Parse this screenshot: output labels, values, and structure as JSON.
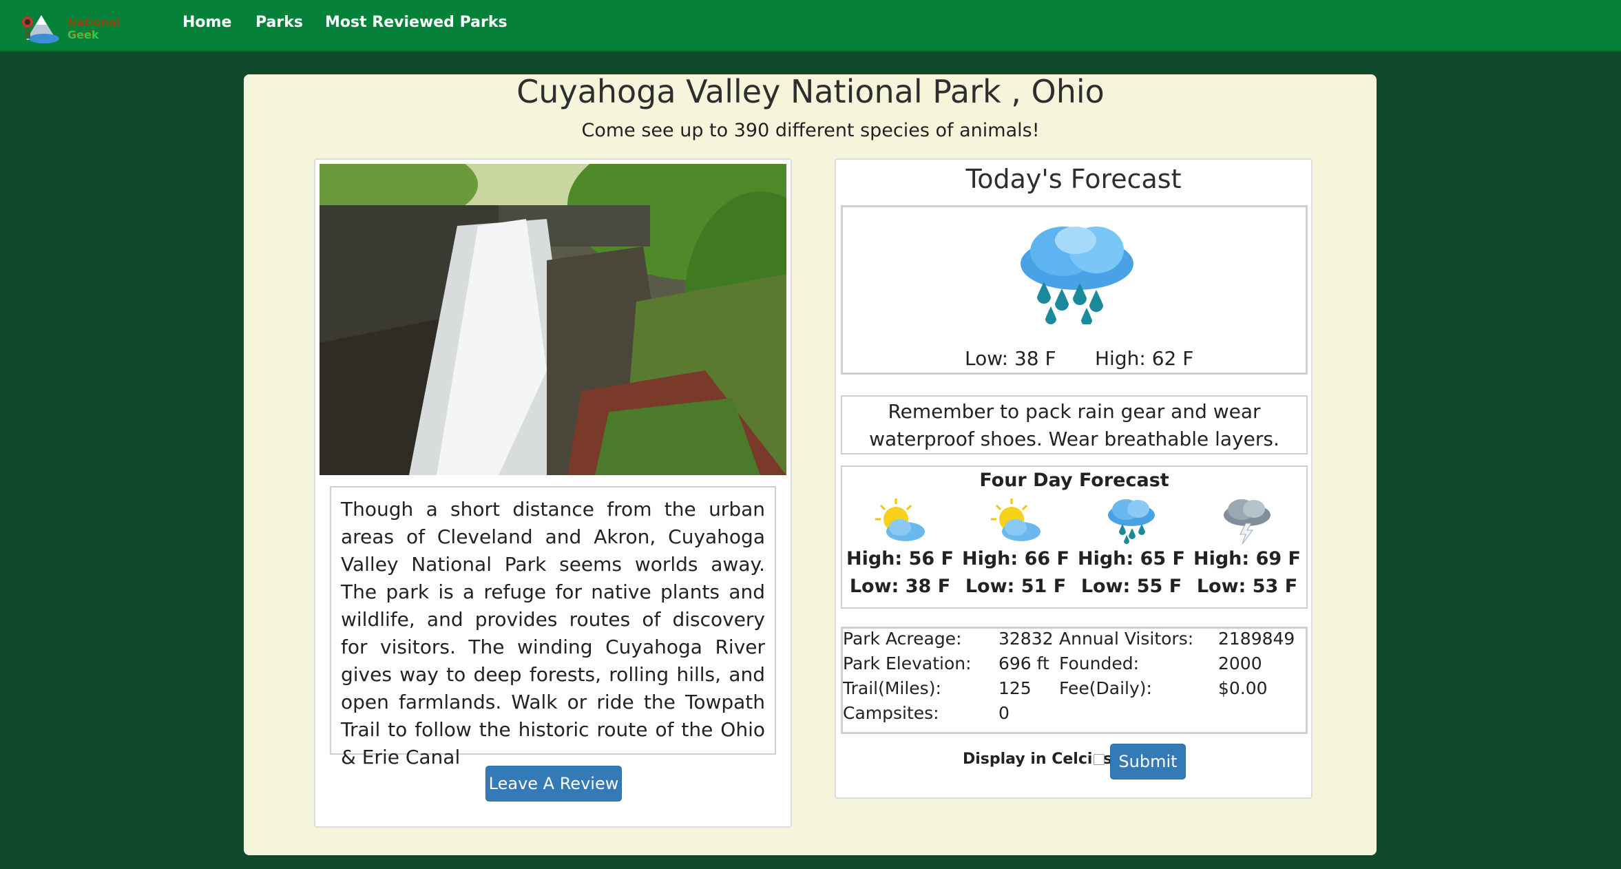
{
  "nav": {
    "logo_line1": "National Park",
    "logo_line2": "Geek",
    "links": [
      "Home",
      "Parks",
      "Most Reviewed Parks"
    ]
  },
  "park": {
    "title": "Cuyahoga Valley National Park , Ohio",
    "subtitle": "Come see up to 390 different species of animals!",
    "description": "Though a short distance from the urban areas of Cleveland and Akron, Cuyahoga Valley National Park seems worlds away. The park is a refuge for native plants and wildlife, and provides routes of discovery for visitors. The winding Cuyahoga River gives way to deep forests, rolling hills, and open farmlands. Walk or ride the Towpath Trail to follow the historic route of the Ohio & Erie Canal",
    "review_button": "Leave A Review"
  },
  "forecast": {
    "title": "Today's Forecast",
    "today_icon": "rain-cloud-icon",
    "low": "Low: 38 F",
    "high": "High: 62 F",
    "tip": "Remember to pack rain gear and wear waterproof shoes. Wear breathable layers.",
    "four_day_title": "Four Day Forecast",
    "days": [
      {
        "icon": "partly-sunny-icon",
        "high": "High: 56 F",
        "low": "Low: 38 F"
      },
      {
        "icon": "partly-sunny-icon",
        "high": "High: 66 F",
        "low": "Low: 51 F"
      },
      {
        "icon": "rain-cloud-icon",
        "high": "High: 65 F",
        "low": "Low: 55 F"
      },
      {
        "icon": "thunderstorm-icon",
        "high": "High: 69 F",
        "low": "Low: 53 F"
      }
    ]
  },
  "stats": {
    "acreage_label": "Park Acreage:",
    "acreage": "32832",
    "visitors_label": "Annual Visitors:",
    "visitors": "2189849",
    "elevation_label": "Park Elevation:",
    "elevation": "696 ft",
    "founded_label": "Founded:",
    "founded": "2000",
    "trail_label": "Trail(Miles):",
    "trail": "125",
    "fee_label": "Fee(Daily):",
    "fee": "$0.00",
    "campsites_label": "Campsites:",
    "campsites": "0"
  },
  "units": {
    "celcius_label": "Display in Celcius",
    "submit": "Submit"
  },
  "colors": {
    "navbar": "#06813a",
    "background": "#0f4a2c",
    "card": "#f5f5dc",
    "button": "#337ab7"
  }
}
